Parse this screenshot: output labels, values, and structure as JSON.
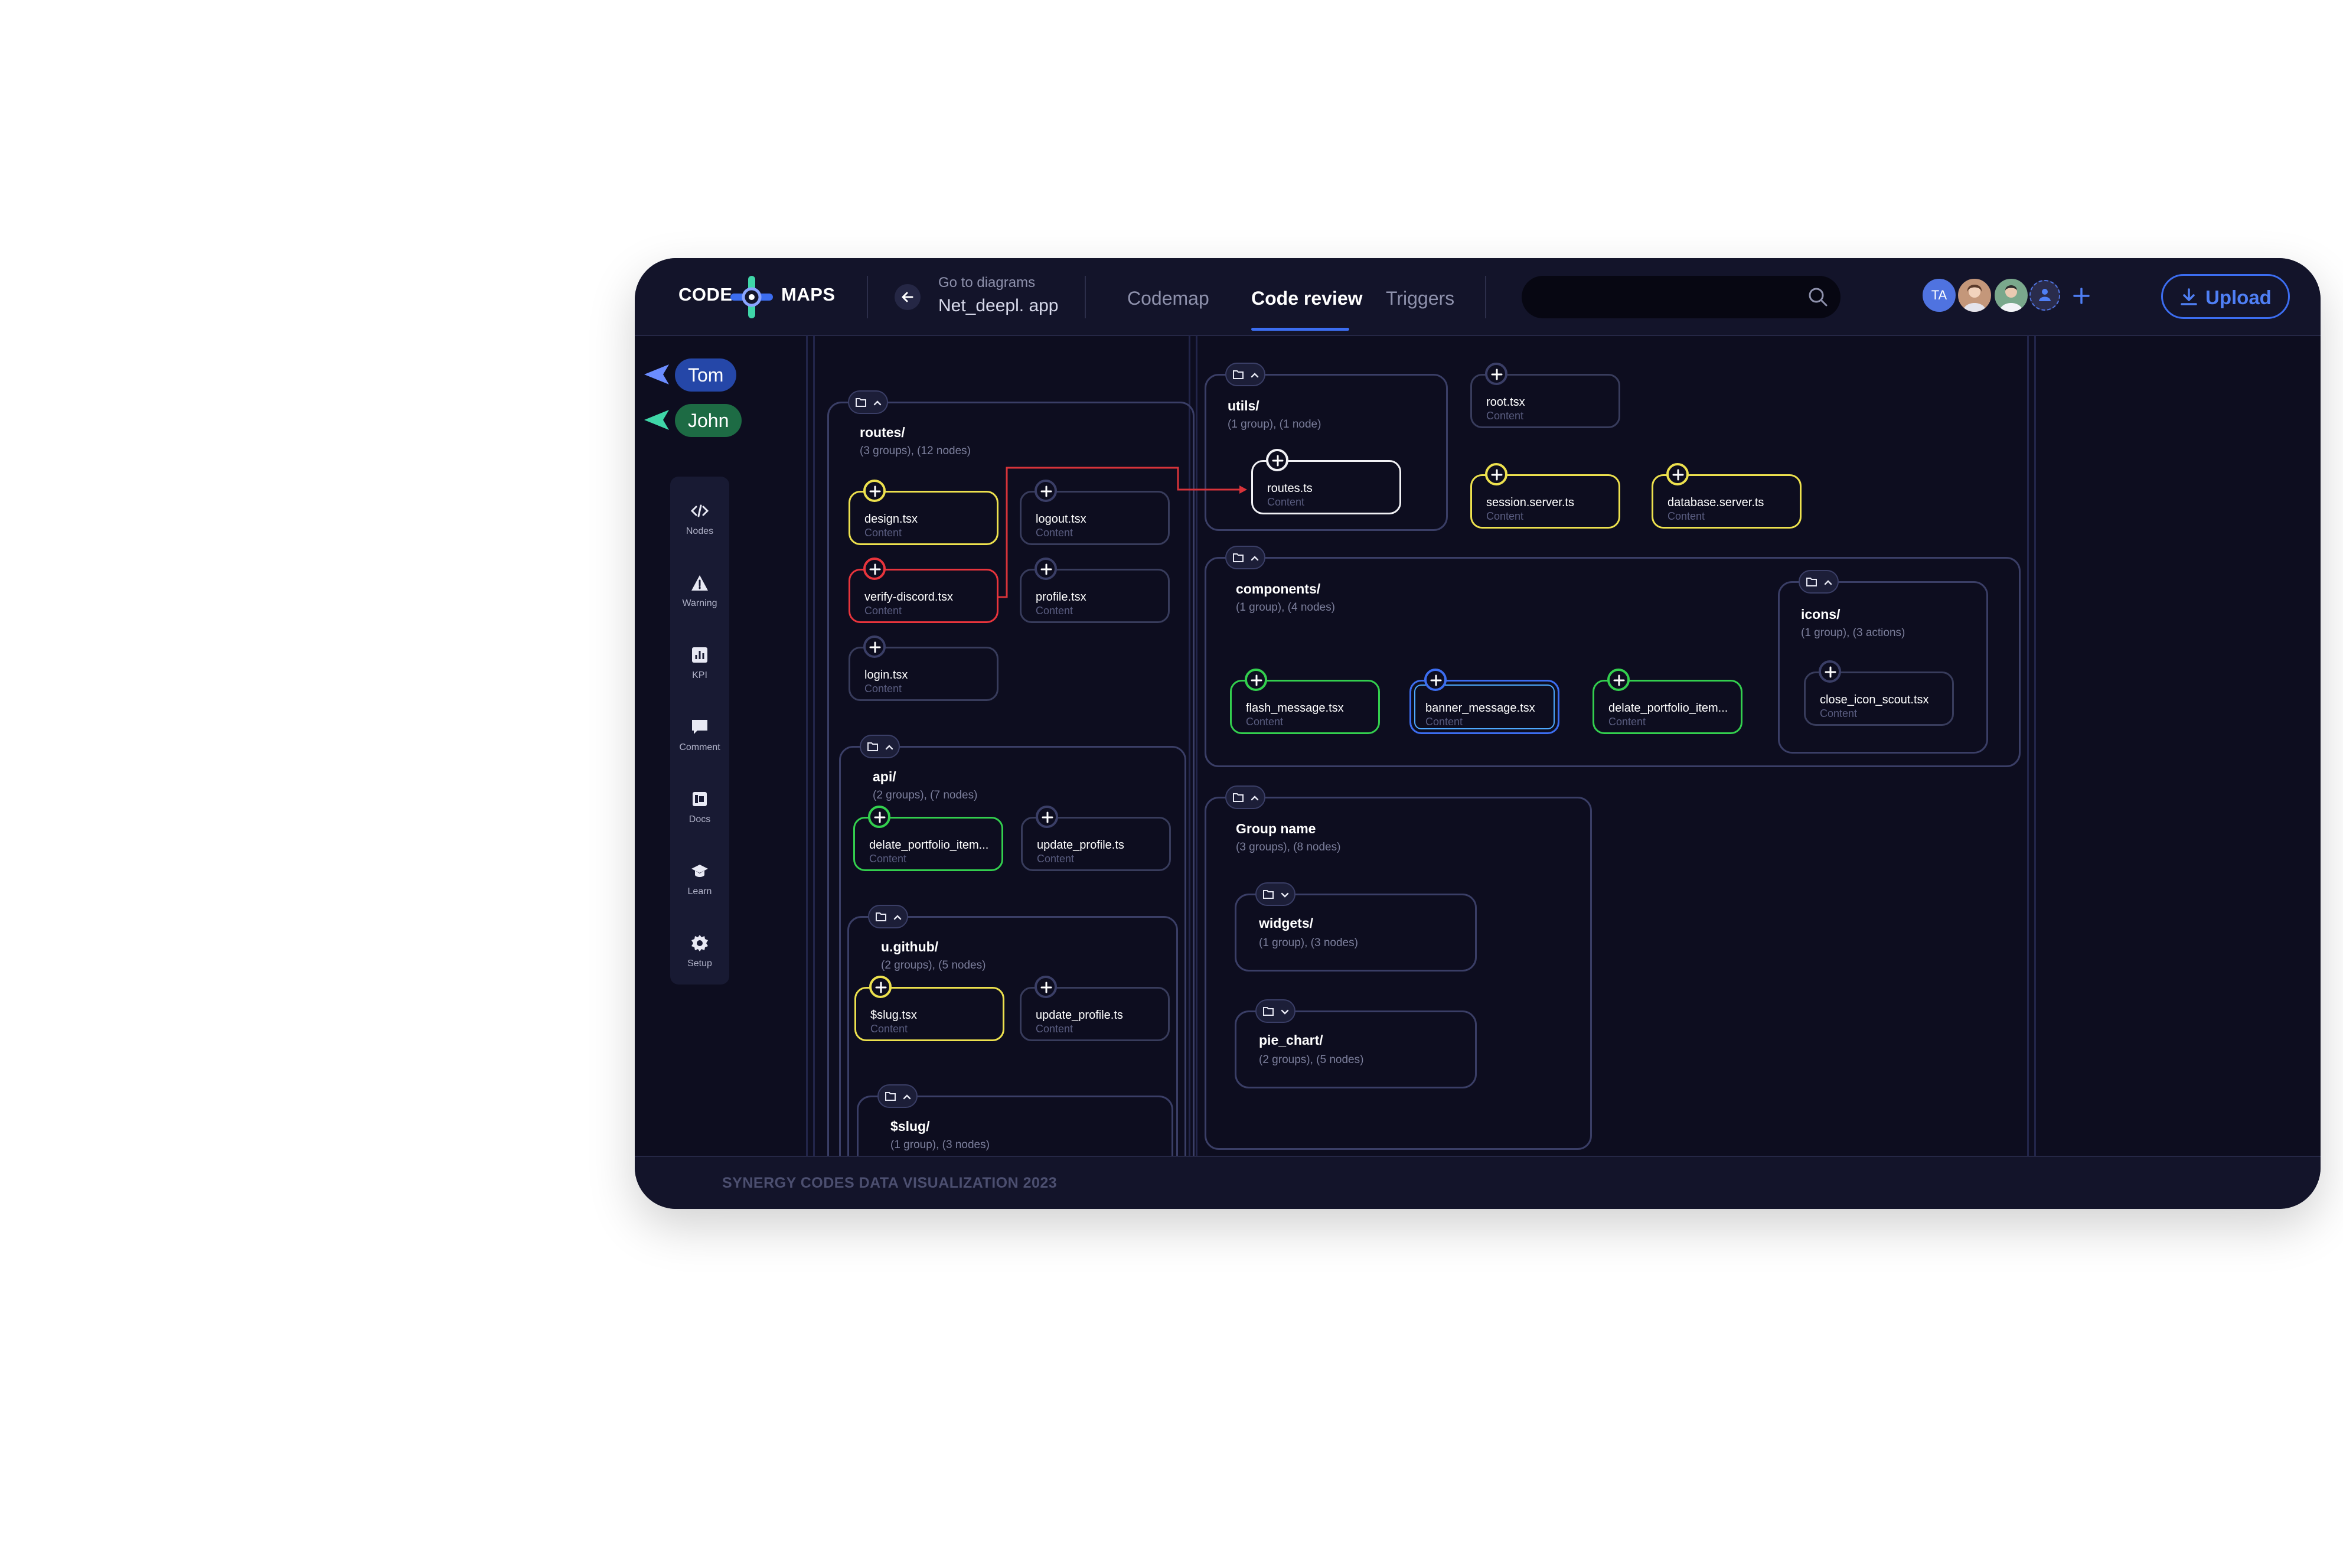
{
  "app": {
    "logo_left": "CODE",
    "logo_right": "MAPS",
    "back_label": "Go to diagrams",
    "project_name": "Net_deepl. app",
    "tabs": [
      {
        "label": "Codemap",
        "active": false
      },
      {
        "label": "Code review",
        "active": true
      },
      {
        "label": "Triggers",
        "active": false
      }
    ],
    "search": {
      "placeholder": "",
      "value": ""
    },
    "avatars": [
      {
        "initials": "TA",
        "color": "#4f73e0"
      },
      {
        "initials": "",
        "color": "#c4977a"
      },
      {
        "initials": "",
        "color": "#7aa88c"
      },
      {
        "initials": "",
        "color": "#2a2c4c"
      }
    ],
    "upload_label": "Upload",
    "accent": "#3c6df0"
  },
  "users": [
    {
      "name": "Tom",
      "color": "#2547a8",
      "arrow_color": "#6b8cff"
    },
    {
      "name": "John",
      "color": "#1d6b44",
      "arrow_color": "#3fd6a8"
    }
  ],
  "sidebar": [
    {
      "label": "Nodes",
      "icon": "code-icon"
    },
    {
      "label": "Warning",
      "icon": "warning-icon"
    },
    {
      "label": "KPI",
      "icon": "chart-icon"
    },
    {
      "label": "Comment",
      "icon": "comment-icon"
    },
    {
      "label": "Docs",
      "icon": "docs-icon"
    },
    {
      "label": "Learn",
      "icon": "learn-icon"
    },
    {
      "label": "Setup",
      "icon": "gear-icon"
    }
  ],
  "groups": {
    "routes": {
      "title": "routes/",
      "sub": "(3 groups), (12 nodes)"
    },
    "api": {
      "title": "api/",
      "sub": "(2 groups), (7 nodes)"
    },
    "ugithub": {
      "title": "u.github/",
      "sub": "(2 groups), (5 nodes)"
    },
    "slug": {
      "title": "$slug/",
      "sub": "(1 group), (3 nodes)"
    },
    "utils": {
      "title": "utils/",
      "sub": "(1 group), (1 node)"
    },
    "components": {
      "title": "components/",
      "sub": "(1 group), (4 nodes)"
    },
    "icons": {
      "title": "icons/",
      "sub": "(1 group), (3 actions)"
    },
    "groupname": {
      "title": "Group name",
      "sub": "(3 groups), (8 nodes)"
    },
    "widgets": {
      "title": "widgets/",
      "sub": "(1 group), (3 nodes)"
    },
    "piechart": {
      "title": "pie_chart/",
      "sub": "(2 groups), (5 nodes)"
    }
  },
  "nodes": {
    "design": {
      "name": "design.tsx",
      "content": "Content",
      "status": "yellow"
    },
    "logout": {
      "name": "logout.tsx",
      "content": "Content",
      "status": "default"
    },
    "verify": {
      "name": "verify-discord.tsx",
      "content": "Content",
      "status": "red"
    },
    "profile": {
      "name": "profile.tsx",
      "content": "Content",
      "status": "default"
    },
    "login": {
      "name": "login.tsx",
      "content": "Content",
      "status": "default"
    },
    "delate1": {
      "name": "delate_portfolio_item...",
      "content": "Content",
      "status": "green"
    },
    "update1": {
      "name": "update_profile.ts",
      "content": "Content",
      "status": "default"
    },
    "slugtsx": {
      "name": "$slug.tsx",
      "content": "Content",
      "status": "yellow"
    },
    "update2": {
      "name": "update_profile.ts",
      "content": "Content",
      "status": "default"
    },
    "routests": {
      "name": "routes.ts",
      "content": "Content",
      "status": "white"
    },
    "root": {
      "name": "root.tsx",
      "content": "Content",
      "status": "default"
    },
    "session": {
      "name": "session.server.ts",
      "content": "Content",
      "status": "yellow"
    },
    "database": {
      "name": "database.server.ts",
      "content": "Content",
      "status": "yellow"
    },
    "flash": {
      "name": "flash_message.tsx",
      "content": "Content",
      "status": "green"
    },
    "banner": {
      "name": "banner_message.tsx",
      "content": "Content",
      "status": "blue"
    },
    "delate2": {
      "name": "delate_portfolio_item...",
      "content": "Content",
      "status": "green"
    },
    "closeicon": {
      "name": "close_icon_scout.tsx",
      "content": "Content",
      "status": "default"
    }
  },
  "colors": {
    "yellow": "#ede14e",
    "red": "#e8343c",
    "green": "#33cf4e",
    "blue": "#3c6df0",
    "white": "#f1f1f5",
    "edge": "#d8333a"
  },
  "footer": {
    "text": "SYNERGY CODES DATA VISUALIZATION 2023"
  }
}
